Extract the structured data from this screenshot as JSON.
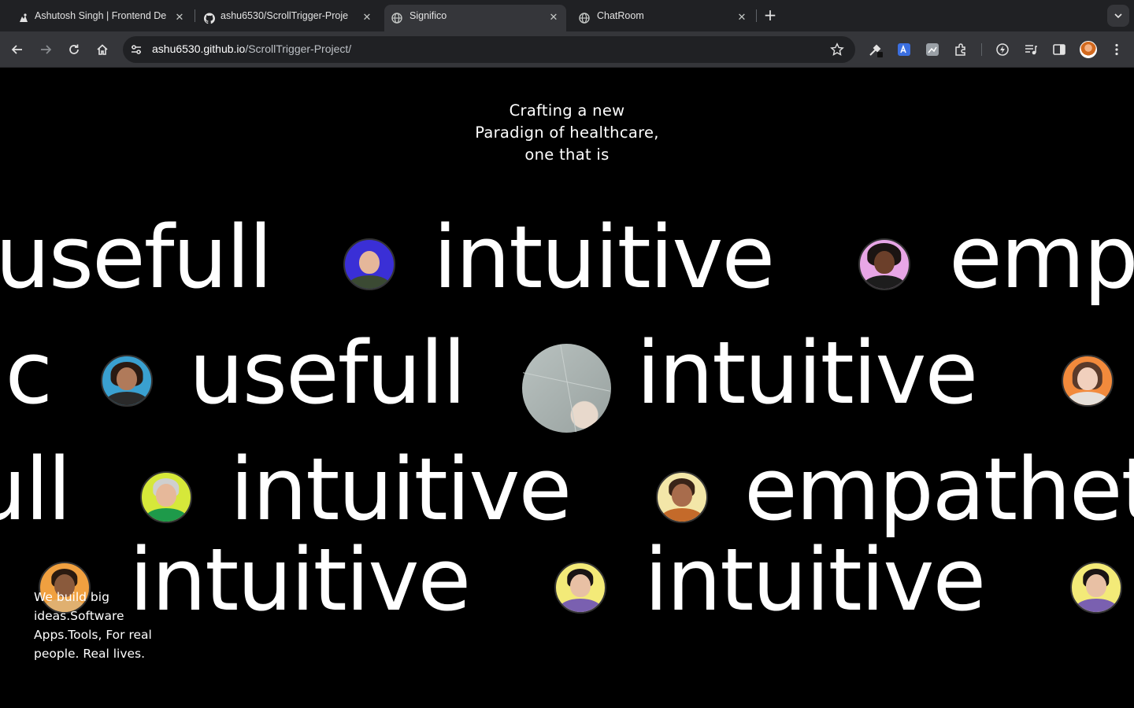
{
  "browser": {
    "tabs": [
      {
        "title": "Ashutosh Singh | Frontend De",
        "icon": "person-favicon-icon",
        "active": false
      },
      {
        "title": "ashu6530/ScrollTrigger-Proje",
        "icon": "github-icon",
        "active": false
      },
      {
        "title": "Significo",
        "icon": "globe-icon",
        "active": true
      },
      {
        "title": "ChatRoom",
        "icon": "globe-icon",
        "active": false
      }
    ],
    "new_tab_label": "+",
    "url_host": "ashu6530.github.io",
    "url_path": "/ScrollTrigger-Project/"
  },
  "hero": {
    "lines": [
      "Crafting a new",
      "Paradign of healthcare,",
      "one that is"
    ]
  },
  "rows": [
    {
      "words": [
        "usefull",
        "intuitive",
        "emp"
      ]
    },
    {
      "words": [
        "ic",
        "usefull",
        "intuitive"
      ]
    },
    {
      "words": [
        "ull",
        "intuitive",
        "empathet"
      ]
    },
    {
      "words": [
        "intuitive",
        "intuitive"
      ]
    }
  ],
  "tagline": {
    "lines": [
      "We build big",
      "ideas.Software",
      "Apps.Tools, For real",
      "people. Real lives."
    ]
  },
  "colors": {
    "background": "#000000",
    "text": "#ffffff",
    "chrome_tabbar": "#202124",
    "chrome_toolbar": "#35363a"
  }
}
